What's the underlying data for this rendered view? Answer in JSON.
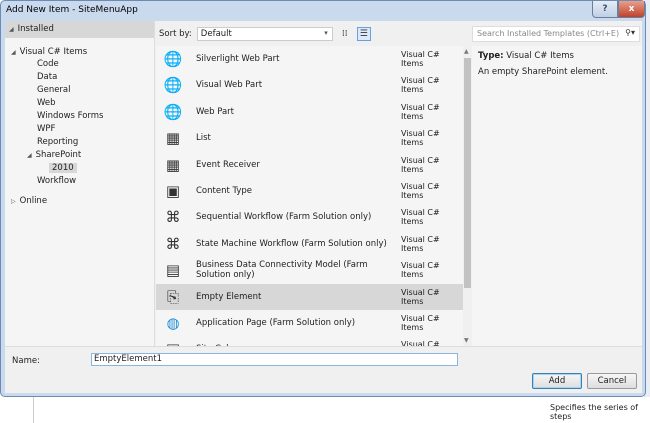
{
  "window": {
    "title": "Add New Item - SiteMenuApp",
    "help": "?",
    "close": "x"
  },
  "tree": {
    "installed": "Installed",
    "visual_cs": "Visual C# Items",
    "children": [
      "Code",
      "Data",
      "General",
      "Web",
      "Windows Forms",
      "WPF",
      "Reporting"
    ],
    "sharepoint": "SharePoint",
    "sp_version": "2010",
    "workflow": "Workflow",
    "online": "Online"
  },
  "toolbar": {
    "sort_label": "Sort by:",
    "sort_value": "Default",
    "search_placeholder": "Search Installed Templates (Ctrl+E)"
  },
  "templates": [
    {
      "name": "Silverlight Web Part",
      "type": "Visual C# Items",
      "icon": "globe-icon"
    },
    {
      "name": "Visual Web Part",
      "type": "Visual C# Items",
      "icon": "globe-icon"
    },
    {
      "name": "Web Part",
      "type": "Visual C# Items",
      "icon": "globe-icon"
    },
    {
      "name": "List",
      "type": "Visual C# Items",
      "icon": "grid-icon"
    },
    {
      "name": "Event Receiver",
      "type": "Visual C# Items",
      "icon": "grid-icon"
    },
    {
      "name": "Content Type",
      "type": "Visual C# Items",
      "icon": "content-type-icon"
    },
    {
      "name": "Sequential Workflow (Farm Solution only)",
      "type": "Visual C# Items",
      "icon": "workflow-icon"
    },
    {
      "name": "State Machine Workflow (Farm Solution only)",
      "type": "Visual C# Items",
      "icon": "workflow-icon"
    },
    {
      "name": "Business Data Connectivity Model (Farm Solution only)",
      "type": "Visual C# Items",
      "icon": "bdc-icon"
    },
    {
      "name": "Empty Element",
      "type": "Visual C# Items",
      "icon": "element-icon"
    },
    {
      "name": "Application Page (Farm Solution only)",
      "type": "Visual C# Items",
      "icon": "app-page-icon"
    },
    {
      "name": "Site Column",
      "type": "Visual C# Items",
      "icon": "column-icon"
    }
  ],
  "selected_index": 9,
  "details": {
    "type_label": "Type:",
    "type_value": "Visual C# Items",
    "description": "An empty SharePoint element."
  },
  "form": {
    "name_label": "Name:",
    "name_value": "EmptyElement1",
    "add": "Add",
    "cancel": "Cancel"
  },
  "background": {
    "text": "Specifies the series of steps"
  }
}
